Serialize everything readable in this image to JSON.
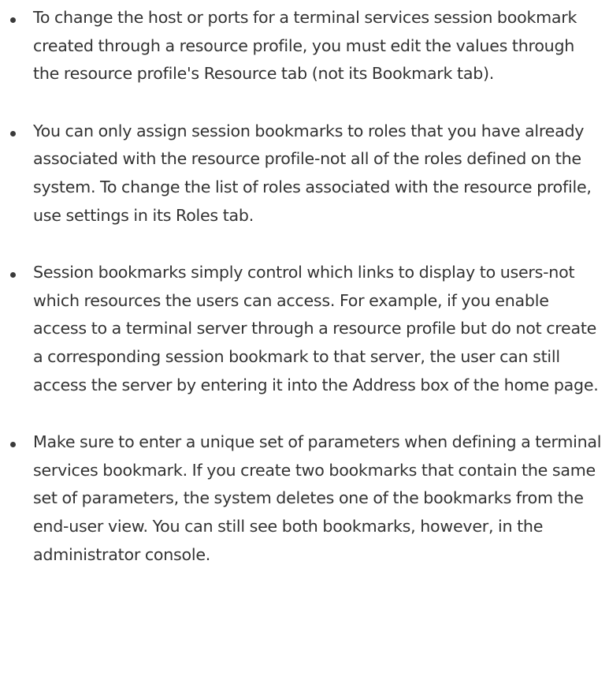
{
  "notes": [
    {
      "text": "To change the host or ports for a terminal services session bookmark created through a resource profile, you must edit the values through the resource profile's Resource tab (not its Bookmark tab)."
    },
    {
      "text": "You can only assign session bookmarks to roles that you have already associated with the resource profile-not all of the roles defined on the system. To change the list of roles associated with the resource profile, use settings in its Roles tab."
    },
    {
      "text": "Session bookmarks simply control which links to display to users-not which resources the users can access. For example, if you enable access to a terminal server through a resource profile but do not create a corresponding session bookmark to that server, the user can still access the server by entering it into the Address box of the home page."
    },
    {
      "text": "Make sure to enter a unique set of parameters when defining a terminal services bookmark. If you create two bookmarks that contain the same set of parameters, the system deletes one of the bookmarks from the end-user view. You can still see both bookmarks, however, in the administrator console."
    }
  ]
}
